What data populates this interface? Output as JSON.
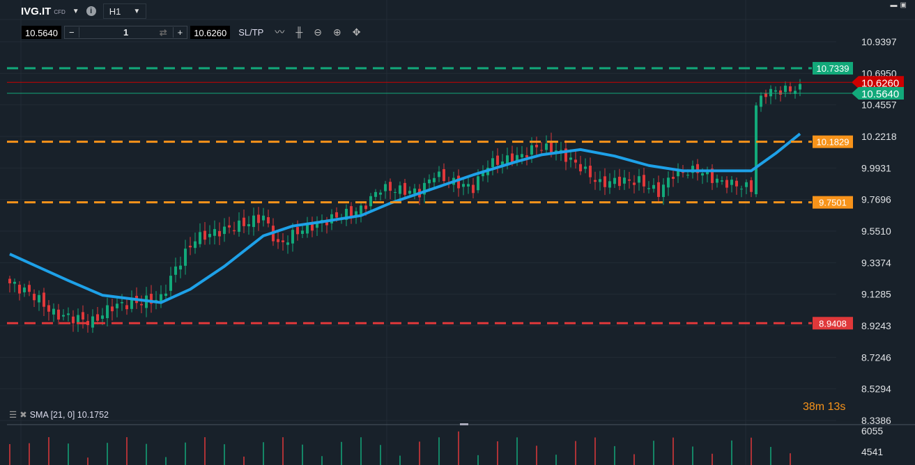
{
  "header": {
    "symbol": "IVG.IT",
    "type": "CFD",
    "timeframe": "H1",
    "bid": "10.5640",
    "ask": "10.6260",
    "quantity": "1",
    "sltp": "SL/TP"
  },
  "indicator": {
    "label": "SMA [21, 0] 10.1752"
  },
  "timer": "38m 13s",
  "colors": {
    "up": "#12a97a",
    "down": "#e0383a",
    "sma": "#1ea1e8",
    "orange": "#f7931a",
    "bg": "#18212a"
  },
  "chart_data": {
    "type": "candlestick",
    "price_ticks": [
      "10.9397",
      "10.6950",
      "10.4557",
      "10.2218",
      "9.9931",
      "9.7696",
      "9.5510",
      "9.3374",
      "9.1285",
      "8.9243",
      "8.7246",
      "8.5294",
      "8.3386"
    ],
    "price_range": [
      8.3386,
      10.9397
    ],
    "volume_ticks": [
      "6055",
      "4541"
    ],
    "levels": [
      {
        "value": "10.7339",
        "color": "#12a97a"
      },
      {
        "value": "10.1829",
        "color": "#f7931a"
      },
      {
        "value": "9.7501",
        "color": "#f7931a"
      },
      {
        "value": "8.9408",
        "color": "#e0383a"
      }
    ],
    "current": [
      {
        "value": "10.6260",
        "color": "#cc0000"
      },
      {
        "value": "10.5640",
        "color": "#12a97a"
      }
    ],
    "close_keypoints": [
      [
        0,
        9.2
      ],
      [
        5,
        9.12
      ],
      [
        9,
        9.0
      ],
      [
        17,
        8.95
      ],
      [
        21,
        9.05
      ],
      [
        31,
        9.1
      ],
      [
        34,
        9.3
      ],
      [
        38,
        9.5
      ],
      [
        48,
        9.6
      ],
      [
        52,
        9.65
      ],
      [
        55,
        9.45
      ],
      [
        59,
        9.55
      ],
      [
        67,
        9.65
      ],
      [
        72,
        9.7
      ],
      [
        76,
        9.85
      ],
      [
        84,
        9.82
      ],
      [
        87,
        9.95
      ],
      [
        90,
        9.9
      ],
      [
        95,
        9.85
      ],
      [
        98,
        10.02
      ],
      [
        105,
        10.08
      ],
      [
        108,
        10.15
      ],
      [
        112,
        10.12
      ],
      [
        117,
        10.0
      ],
      [
        121,
        9.88
      ],
      [
        124,
        9.9
      ],
      [
        129,
        9.9
      ],
      [
        133,
        9.82
      ],
      [
        136,
        9.95
      ],
      [
        141,
        9.98
      ],
      [
        145,
        9.9
      ],
      [
        152,
        9.85
      ],
      [
        153,
        10.45
      ],
      [
        155,
        10.55
      ],
      [
        162,
        10.58
      ]
    ],
    "sma": [
      [
        0,
        9.395
      ],
      [
        12,
        9.218
      ],
      [
        19,
        9.122
      ],
      [
        31,
        9.074
      ],
      [
        37,
        9.161
      ],
      [
        44,
        9.313
      ],
      [
        52,
        9.519
      ],
      [
        58,
        9.586
      ],
      [
        64,
        9.615
      ],
      [
        72,
        9.658
      ],
      [
        78,
        9.744
      ],
      [
        87,
        9.849
      ],
      [
        95,
        9.944
      ],
      [
        104,
        10.04
      ],
      [
        109,
        10.088
      ],
      [
        117,
        10.126
      ],
      [
        124,
        10.079
      ],
      [
        131,
        10.011
      ],
      [
        138,
        9.973
      ],
      [
        147,
        9.973
      ],
      [
        152,
        9.973
      ],
      [
        157,
        10.098
      ],
      [
        162,
        10.241
      ]
    ]
  }
}
